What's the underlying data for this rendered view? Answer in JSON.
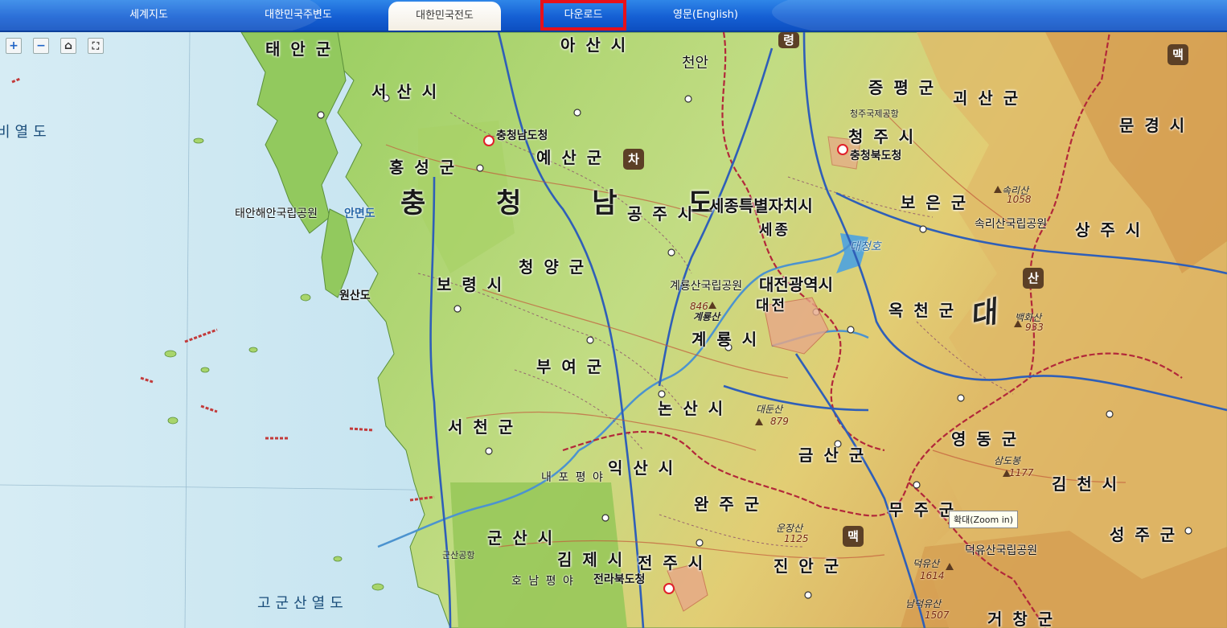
{
  "nav": {
    "world": "세계지도",
    "peripheral": "대한민국주변도",
    "national": "대한민국전도",
    "download": "다운로드",
    "english": "영문(English)"
  },
  "controls": {
    "zoom_in": "+",
    "zoom_out": "−",
    "home": "⌂",
    "full": "⛶"
  },
  "tooltip": "확대(Zoom in)",
  "province": "충 청 남 도",
  "counties": {
    "taean": "태 안 군",
    "seosan": "서 산 시",
    "hongseong": "홍 성 군",
    "yesan": "예 산 군",
    "asan": "아 산 시",
    "cheonan": "천안",
    "boryeong": "보 령 시",
    "cheongyang": "청 양 군",
    "gongju": "공 주 시",
    "sejong": "세종특별자치시",
    "daejeon": "대전광역시",
    "gyeryong": "계 룡 시",
    "buyeo": "부 여 군",
    "nonsan": "논 산 시",
    "seocheon": "서 천 군",
    "iksan": "익 산 시",
    "gunsan": "군 산 시",
    "gimje": "김 제 시",
    "jeonju": "전 주 시",
    "wanju": "완 주 군",
    "jinan": "진 안 군",
    "muju": "무 주 군",
    "geumsan": "금 산 군",
    "okcheon": "옥 천 군",
    "yeongdong": "영 동 군",
    "boeun": "보 은 군",
    "cheongju": "청 주 시",
    "jeungpyeong": "증 평 군",
    "goesan": "괴 산 군",
    "mungyeong": "문 경 시",
    "sangju": "상 주 시",
    "gimcheon": "김 천 시",
    "seongju": "성 주 군",
    "geochang": "거 창 군"
  },
  "places": {
    "chungnam_office": "충청남도청",
    "chungbuk_office": "충청북도청",
    "jeonbuk_office": "전라북도청",
    "taean_park": "태안해안국립공원",
    "gyeryong_park": "계룡산국립공원",
    "songni_park": "속리산국립공원",
    "deogyu_park": "덕유산국립공원",
    "gogunsan": "고군산열도",
    "bieyeoldo": "비열도",
    "naepo": "내 포 평 야",
    "honam": "호 남 평 야",
    "anmyeondo": "안면도",
    "wonsando": "원산도",
    "daecheong": "대청호",
    "cheongju_airport": "청주국제공항",
    "gunsan_airport": "군산공항",
    "daejeon_city": "대전",
    "sejong_city": "세종"
  },
  "peaks": {
    "gyeryongsan": "계룡산",
    "gyeryong_h": "846",
    "songnisan": "속리산",
    "songni_h": "1058",
    "baekhwasan": "백화산",
    "baekhwa_h": "933",
    "daedunsan": "대둔산",
    "daedun_h": "879",
    "ungjangsan": "운장산",
    "ungjang_h": "1125",
    "deogyusan": "덕유산",
    "deogyu_h": "1614",
    "samdobong": "삼도봉",
    "samdo_h": "1177",
    "namdeogyu": "남덕유산",
    "namdeogyu_h": "1507"
  },
  "big_tag": "대",
  "badges": {
    "cha": "차",
    "san": "산",
    "maek": "맥",
    "ryeong": "령",
    "maek2": "맥"
  },
  "colors": {
    "sea": "#bfe0ee",
    "lowland": "#8fc65a",
    "plain": "#b7d97a",
    "highland": "#e3c76a",
    "mountain": "#d99a4e",
    "border": "#b2283a",
    "highway": "#2f5fb8"
  }
}
